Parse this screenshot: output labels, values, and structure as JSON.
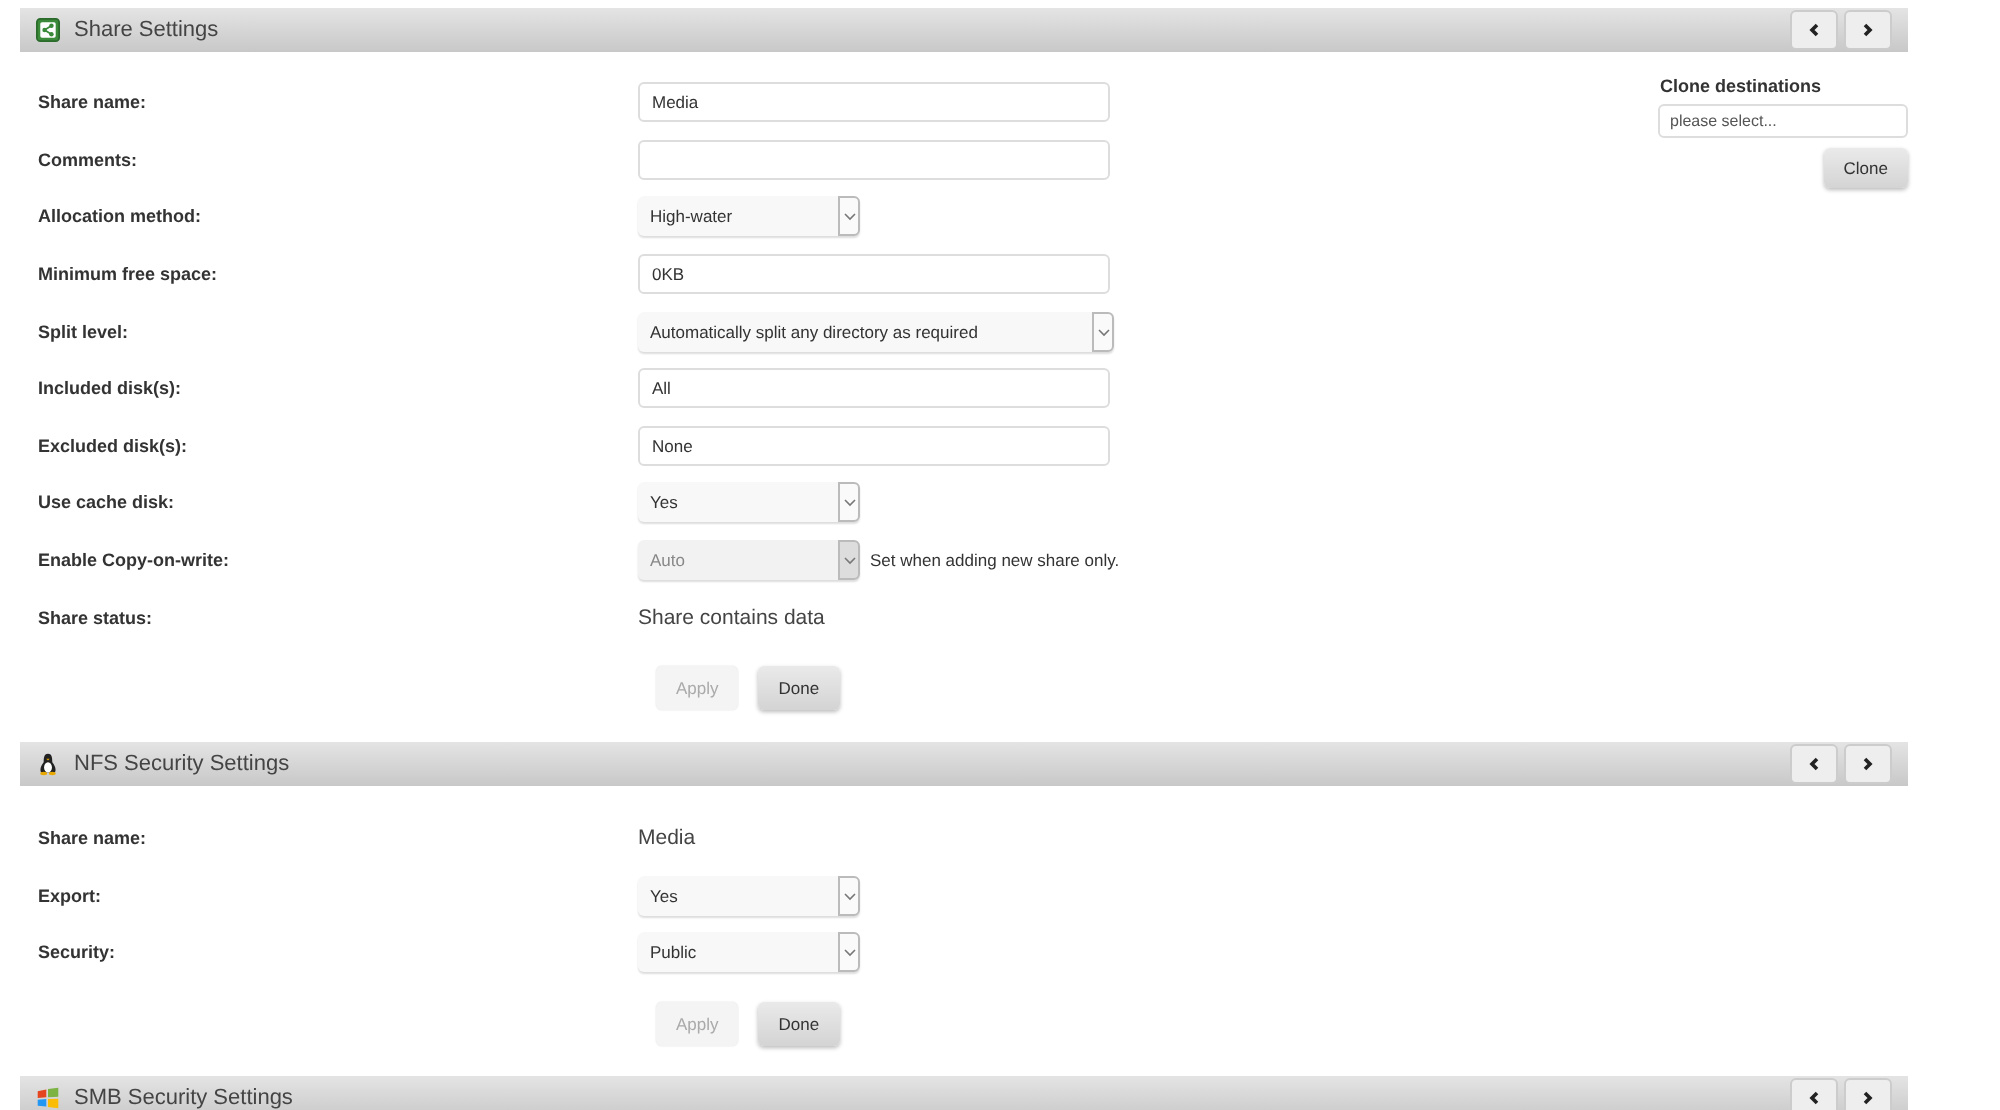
{
  "sections": [
    {
      "title": "Share Settings",
      "kind": "share",
      "rows": [
        {
          "label": "Share name:",
          "kind": "input",
          "value": "Media"
        },
        {
          "label": "Comments:",
          "kind": "input"
        },
        {
          "label": "Allocation method:",
          "kind": "select",
          "value": "High-water",
          "disabled": false
        },
        {
          "label": "Minimum free space:",
          "kind": "input",
          "value": "0KB"
        },
        {
          "label": "Split level:",
          "kind": "wideselect",
          "value": "Automatically split any directory as required",
          "disabled": false
        },
        {
          "label": "Included disk(s):",
          "kind": "input",
          "value": "All"
        },
        {
          "label": "Excluded disk(s):",
          "kind": "input",
          "value": "None"
        },
        {
          "label": "Use cache disk:",
          "kind": "select",
          "value": "Yes",
          "disabled": false
        },
        {
          "label": "Enable Copy-on-write:",
          "kind": "select",
          "value": "Auto",
          "disabled": true,
          "note": "Set when adding new share only."
        },
        {
          "label": "Share status:",
          "kind": "text",
          "value": "Share contains data"
        }
      ],
      "buttons": [
        {
          "label": "Apply",
          "disabled": true
        },
        {
          "label": "Done",
          "disabled": false
        }
      ],
      "clone": {
        "title": "Clone destinations",
        "placeholder": "please select...",
        "button": "Clone"
      }
    },
    {
      "title": "NFS Security Settings",
      "kind": "nfs",
      "rows": [
        {
          "label": "Share name:",
          "kind": "text",
          "value": "Media"
        },
        {
          "label": "Export:",
          "kind": "select",
          "value": "Yes",
          "disabled": false
        },
        {
          "label": "Security:",
          "kind": "select",
          "value": "Public",
          "disabled": false
        }
      ],
      "buttons": [
        {
          "label": "Apply",
          "disabled": true
        },
        {
          "label": "Done",
          "disabled": false
        }
      ]
    },
    {
      "title": "SMB Security Settings",
      "kind": "smb"
    }
  ]
}
